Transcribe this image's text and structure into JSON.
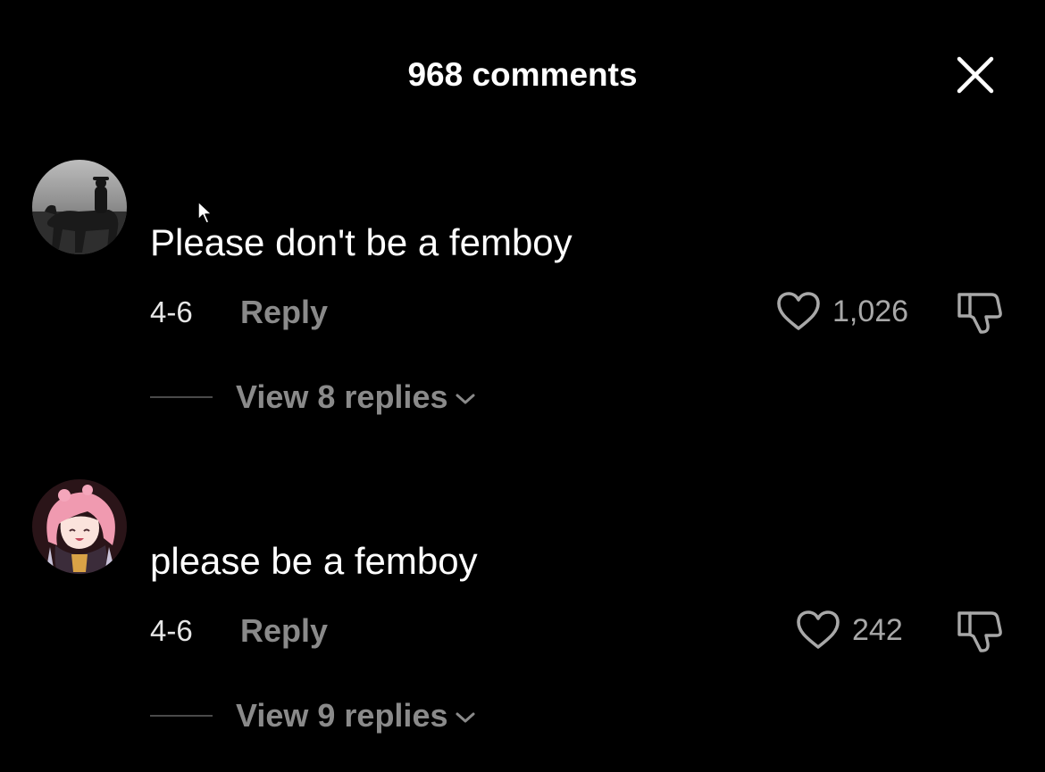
{
  "header": {
    "title": "968 comments",
    "close_icon": "close-icon"
  },
  "comments": [
    {
      "avatar_icon": "avatar-rider-on-horse",
      "text": "Please don't be a femboy",
      "date": "4-6",
      "reply_label": "Reply",
      "likes": "1,026",
      "like_icon": "heart-outline-icon",
      "dislike_icon": "thumbs-down-icon",
      "view_replies_label": "View 8 replies",
      "expand_icon": "chevron-down-icon"
    },
    {
      "avatar_icon": "avatar-anime-pink-hair",
      "text": "please be a femboy",
      "date": "4-6",
      "reply_label": "Reply",
      "likes": "242",
      "like_icon": "heart-outline-icon",
      "dislike_icon": "thumbs-down-icon",
      "view_replies_label": "View 9 replies",
      "expand_icon": "chevron-down-icon"
    }
  ],
  "colors": {
    "background": "#000000",
    "text_primary": "#ffffff",
    "text_secondary": "#8a8a8a",
    "like_count": "#a8a8a8"
  }
}
